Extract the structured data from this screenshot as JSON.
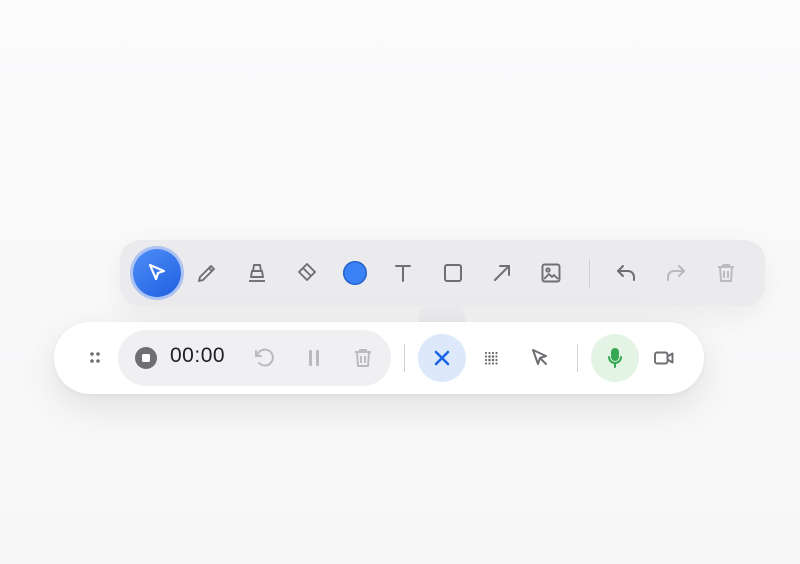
{
  "toolbar": {
    "tools": [
      {
        "name": "select-tool",
        "icon": "cursor-arrow-icon",
        "active": true
      },
      {
        "name": "pen-tool",
        "icon": "pencil-icon"
      },
      {
        "name": "highlighter-tool",
        "icon": "highlighter-icon"
      },
      {
        "name": "eraser-tool",
        "icon": "eraser-icon"
      },
      {
        "name": "color-picker",
        "icon": "color-swatch-icon",
        "color": "#3b82f6"
      },
      {
        "name": "text-tool",
        "icon": "text-t-icon"
      },
      {
        "name": "rectangle-tool",
        "icon": "square-icon"
      },
      {
        "name": "arrow-tool",
        "icon": "diagonal-arrow-icon"
      },
      {
        "name": "image-tool",
        "icon": "image-icon"
      },
      {
        "name": "undo-button",
        "icon": "undo-icon"
      },
      {
        "name": "redo-button",
        "icon": "redo-icon",
        "disabled": true
      },
      {
        "name": "clear-button",
        "icon": "trash-icon",
        "disabled": true
      }
    ],
    "accent_color": "#2f6ff0"
  },
  "recorder": {
    "timer": "00:00",
    "controls": [
      {
        "name": "drag-handle",
        "icon": "grip-dots-icon"
      },
      {
        "name": "stop-button",
        "icon": "stop-circle-icon"
      },
      {
        "name": "restart-button",
        "icon": "restart-icon",
        "disabled": true
      },
      {
        "name": "pause-button",
        "icon": "pause-icon",
        "disabled": true
      },
      {
        "name": "delete-button",
        "icon": "trash-icon",
        "disabled": true
      },
      {
        "name": "close-drawing-button",
        "icon": "close-icon",
        "color": "#1a66e8"
      },
      {
        "name": "spotlight-button",
        "icon": "dot-grid-icon"
      },
      {
        "name": "pointer-button",
        "icon": "pointer-icon"
      },
      {
        "name": "microphone-button",
        "icon": "microphone-icon",
        "color": "#34a853"
      },
      {
        "name": "camera-button",
        "icon": "video-camera-icon"
      }
    ]
  }
}
